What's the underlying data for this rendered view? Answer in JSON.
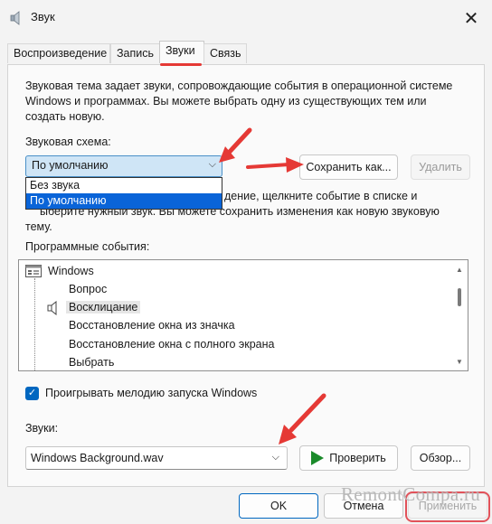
{
  "window": {
    "title": "Звук",
    "close": "✕"
  },
  "tabs": [
    {
      "label": "Воспроизведение"
    },
    {
      "label": "Запись"
    },
    {
      "label": "Звуки"
    },
    {
      "label": "Связь"
    }
  ],
  "description": "Звуковая тема задает звуки, сопровождающие события в операционной системе Windows и программах. Вы можете выбрать одну из существующих тем или создать новую.",
  "scheme": {
    "label": "Звуковая схема:",
    "selected": "По умолчанию",
    "options": [
      "Без звука",
      "По умолчанию"
    ],
    "save_as": "Сохранить как...",
    "delete": "Удалить"
  },
  "instructions": "Чтобы изменить звуки, щелкните событие в списке и выберите нужный звук. Вы можете сохранить изменения как новую звуковую тему.",
  "instructions_visible_1": "дение, щелкните событие в списке и",
  "instructions_visible_2": "ыберите нужный звук. Вы можете сохранить изменения как новую звуковую",
  "instructions_visible_3": "тему.",
  "events": {
    "label": "Программные события:",
    "root": "Windows",
    "items": [
      "Вопрос",
      "Восклицание",
      "Восстановление окна из значка",
      "Восстановление окна с полного экрана",
      "Выбрать"
    ],
    "selected": "Восклицание"
  },
  "startup_checkbox": {
    "label": "Проигрывать мелодию запуска Windows",
    "checked": true
  },
  "sounds": {
    "label": "Звуки:",
    "value": "Windows Background.wav",
    "test": "Проверить",
    "browse": "Обзор..."
  },
  "footer": {
    "ok": "OK",
    "cancel": "Отмена",
    "apply": "Применить"
  },
  "watermark": "RemontCompa.ru",
  "colors": {
    "accent": "#0067c0",
    "annotation": "#e53935",
    "selection": "#0a64d8"
  }
}
